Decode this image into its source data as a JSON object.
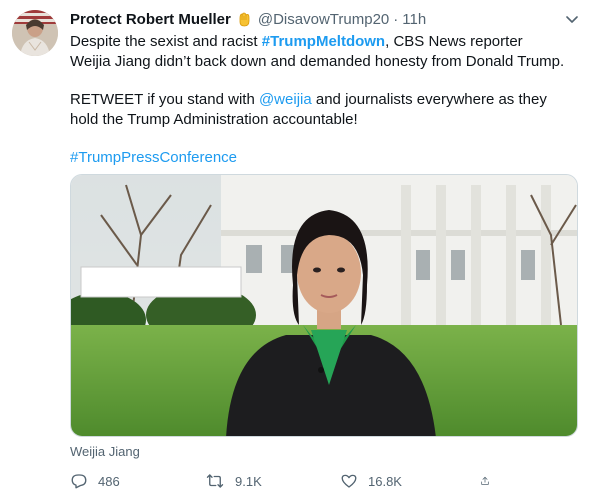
{
  "tweet": {
    "display_name": "Protect Robert Mueller",
    "badge_icon": "raised-fist-icon",
    "handle": "@DisavowTrump20",
    "separator": "·",
    "time": "11h",
    "text": {
      "p1_a": "Despite the sexist and racist ",
      "p1_hashtag": "#TrumpMeltdown",
      "p1_b": ", CBS News reporter",
      "p1_line2": "Weijia Jiang didn’t back down and demanded honesty from Donald Trump.",
      "p2_a": "RETWEET if you stand with ",
      "p2_mention": "@weijia",
      "p2_b": " and journalists everywhere as they",
      "p2_line2": "hold the Trump Administration accountable!",
      "p3_hashtag": "#TrumpPressConference"
    },
    "media_caption": "Weijia Jiang",
    "actions": {
      "reply_icon": "reply-icon",
      "reply_count": "486",
      "retweet_icon": "retweet-icon",
      "retweet_count": "9.1K",
      "like_icon": "heart-icon",
      "like_count": "16.8K",
      "share_icon": "share-icon"
    }
  },
  "colors": {
    "link": "#1d9bf0",
    "secondary_text": "#536471",
    "primary_text": "#0f1419"
  }
}
